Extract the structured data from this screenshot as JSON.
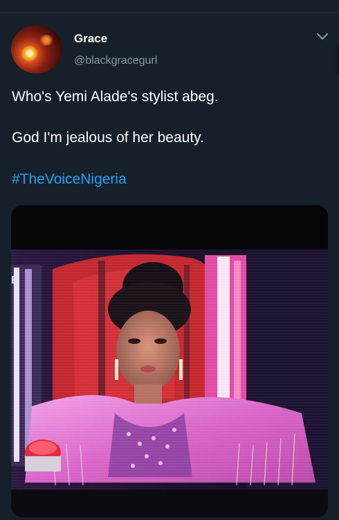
{
  "tweet": {
    "author": {
      "display_name": "Grace",
      "handle": "@blackgracegurl",
      "avatar_icon": "avatar-photo"
    },
    "menu_icon": "chevron-down-icon",
    "text_lines": [
      "Who's Yemi Alade's stylist abeg.",
      "God I'm jealous of her beauty."
    ],
    "hashtag": "#TheVoiceNigeria",
    "media": {
      "kind": "photo",
      "screen_fragment_text": "E"
    }
  },
  "colors": {
    "background": "#15202b",
    "text_primary": "#ffffff",
    "text_secondary": "#8899a6",
    "link": "#1da1f2"
  }
}
